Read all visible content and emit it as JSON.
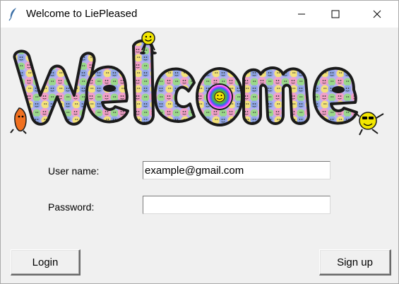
{
  "window": {
    "title": "Welcome to LiePleased",
    "controls": [
      "minimize-icon",
      "maximize-icon",
      "close-icon"
    ]
  },
  "banner": {
    "text": "Welcome",
    "style": "smiley-face patterned bubble letters with dancing smileys",
    "colors": {
      "outline": "#1a1a1a",
      "fill_pink": "#f2a0c8",
      "fill_blue": "#8fa6e8",
      "fill_green": "#9ad88a",
      "fill_yellow": "#f3e27a",
      "fill_orange": "#f0a050",
      "smiley": "#f2e600"
    }
  },
  "form": {
    "username_label": "User name:",
    "username_value": "example@gmail.com",
    "password_label": "Password:",
    "password_value": ""
  },
  "buttons": {
    "login": "Login",
    "signup": "Sign up"
  }
}
